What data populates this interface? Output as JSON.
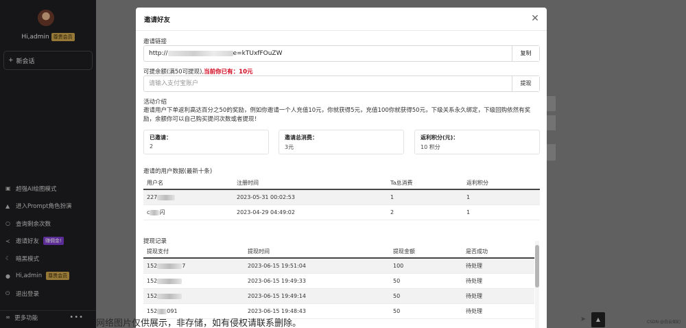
{
  "sidebar": {
    "username": "Hi,admin",
    "vip_badge": "尊贵会员",
    "new_chat": "新会话",
    "items": [
      {
        "label": "超强AI绘图模式",
        "icon": "image-icon"
      },
      {
        "label": "进入Prompt角色扮演",
        "icon": "graduation-cap-icon"
      },
      {
        "label": "查询剩余次数",
        "icon": "search-icon"
      },
      {
        "label": "邀请好友",
        "icon": "share-icon",
        "badge": "赚佣金!"
      },
      {
        "label": "暗黑模式",
        "icon": "moon-icon"
      },
      {
        "label": "Hi,admin",
        "icon": "user-icon",
        "badge": "尊贵会员"
      },
      {
        "label": "退出登录",
        "icon": "logout-icon"
      }
    ],
    "more": "更多功能"
  },
  "modal": {
    "title": "邀请好友",
    "invite_link_label": "邀请链接",
    "invite_link_prefix": "http://",
    "invite_link_suffix": "e=kTUxfFOuZW",
    "copy_button": "复制",
    "withdraw_label": "可提余额(满50可提现),",
    "current_balance": "当前你已有：10元",
    "alipay_placeholder": "请输入支付宝账户",
    "withdraw_button": "提现",
    "activity_title": "活动介绍",
    "activity_text": "邀请用户下单返利高达百分之50的奖励，例如你邀请一个人充值10元，你就获得5元，充值100你就获得50元，下级关系永久绑定，下级回购依然有奖励，余额你可以自己购买提问次数或者提现！",
    "stats": [
      {
        "title": "已邀请：",
        "value": "2"
      },
      {
        "title": "邀请总消费：",
        "value": "3元"
      },
      {
        "title": "返利积分(元)：",
        "value": "10 积分"
      }
    ],
    "invited_title": "邀请的用户数据(最新十条)",
    "invited_headers": [
      "用户名",
      "注册时间",
      "Ta总消费",
      "返利积分"
    ],
    "invited_rows": [
      {
        "user": "227",
        "time": "2023-05-31 00:02:53",
        "spend": "1",
        "points": "1"
      },
      {
        "user": "c",
        "user_tail": "闪",
        "time": "2023-04-29 04:49:02",
        "spend": "2",
        "points": "1"
      }
    ],
    "withdraw_title": "提现记录",
    "withdraw_headers": [
      "提现支付",
      "提现时间",
      "提现金额",
      "是否成功"
    ],
    "withdraw_rows": [
      {
        "account": "152",
        "account_tail": "7",
        "time": "2023-06-15 19:51:04",
        "amount": "100",
        "status": "待处理"
      },
      {
        "account": "152",
        "account_tail": "",
        "time": "2023-06-15 19:49:33",
        "amount": "50",
        "status": "待处理"
      },
      {
        "account": "152",
        "account_tail": "",
        "time": "2023-06-15 19:49:14",
        "amount": "50",
        "status": "待处理"
      },
      {
        "account": "152",
        "account_tail": "091",
        "time": "2023-06-15 19:48:43",
        "amount": "50",
        "status": "待处理"
      }
    ]
  },
  "watermark": "网络图片仅供展示，非存储，如有侵权请联系删除。",
  "csdn": "CSDN @白云如幻"
}
